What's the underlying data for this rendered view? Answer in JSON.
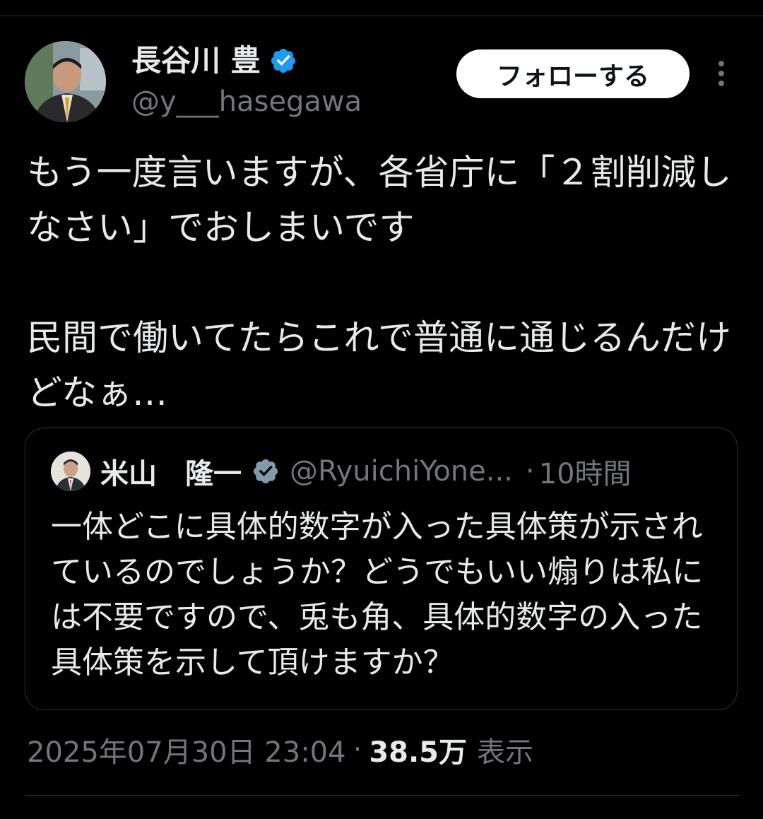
{
  "tweet": {
    "author": {
      "name": "長谷川 豊",
      "handle": "@y___hasegawa",
      "verified": true
    },
    "follow_label": "フォローする",
    "text": "もう一度言いますが、各省庁に「２割削減しなさい」でおしまいです\n\n民間で働いてたらこれで普通に通じるんだけどなぁ…",
    "quote": {
      "name": "米山　隆一",
      "handle": "@RyuichiYone...",
      "separator": "·",
      "time": "10時間",
      "text": "一体どこに具体的数字が入った具体策が示されているのでしょうか？どうでもいい煽りは私には不要ですので、兎も角、具体的数字の入った具体策を示して頂けますか？"
    },
    "timestamp": "2025年07月30日 23:04",
    "meta_separator": "·",
    "views_count": "38.5万",
    "views_label": "表示"
  },
  "colors": {
    "background": "#000000",
    "text_primary": "#e7e9ea",
    "text_secondary": "#71767b",
    "verified_blue": "#1d9bf0",
    "verified_gray": "#829aab",
    "border": "#2f3336"
  },
  "icons": {
    "author_verified": "verified-badge-icon",
    "quote_verified": "verified-badge-gray-icon",
    "more": "more-vertical-icon"
  }
}
